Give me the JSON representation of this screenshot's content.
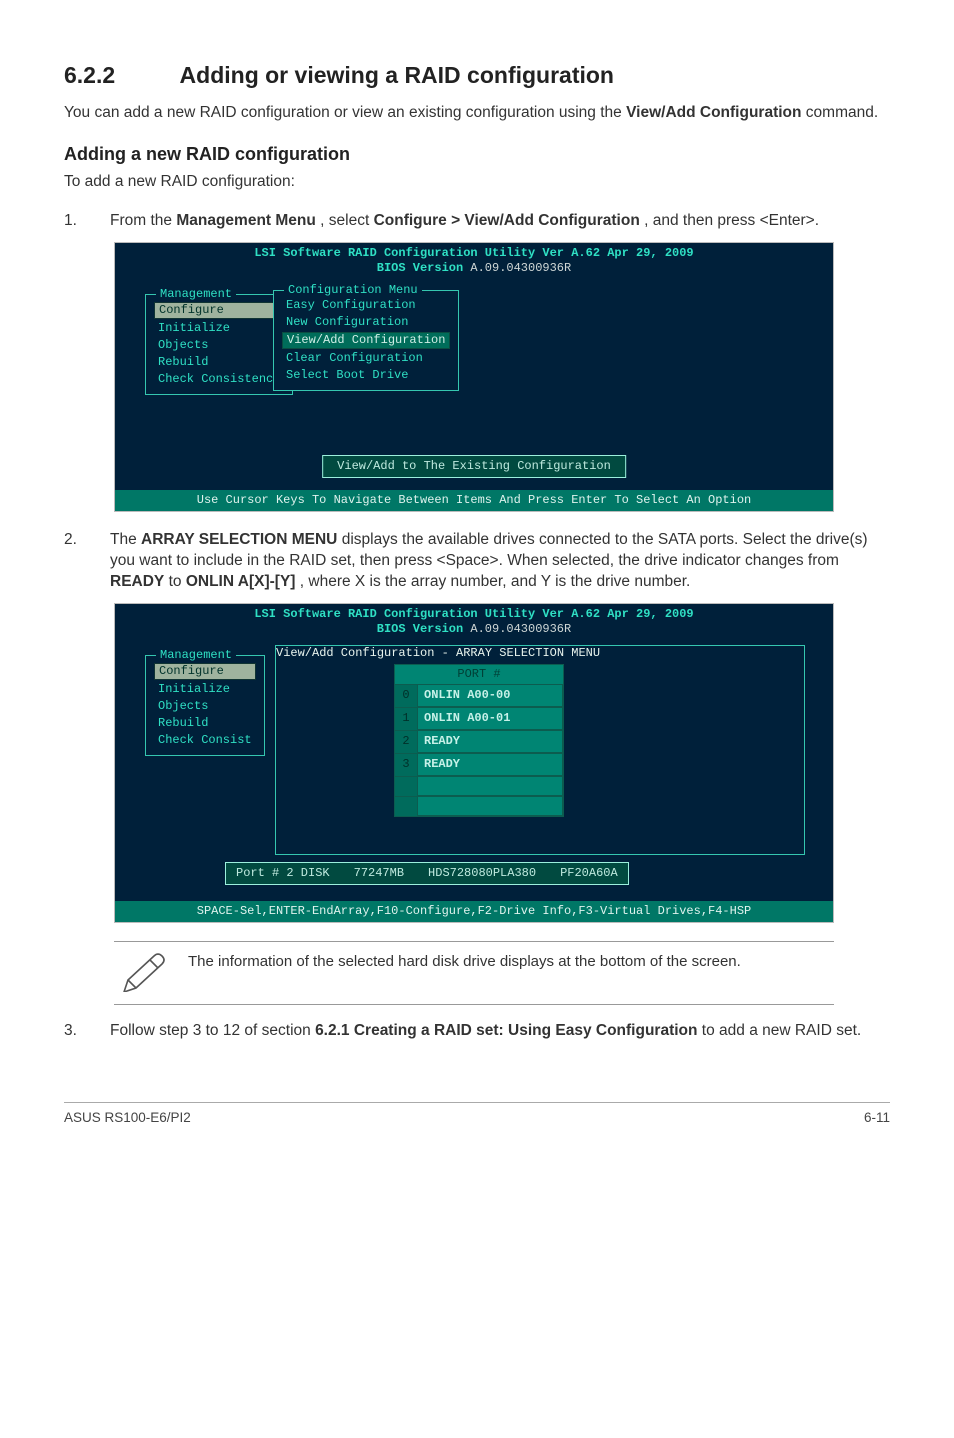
{
  "section": {
    "number": "6.2.2",
    "title": "Adding or viewing a RAID configuration"
  },
  "intro": {
    "p1a": "You can add a new RAID configuration or view an existing configuration using the ",
    "p1b": "View/Add Configuration",
    "p1c": " command."
  },
  "sub": {
    "title": "Adding a new RAID configuration",
    "lead": "To add a new RAID configuration:"
  },
  "steps": {
    "s1": {
      "num": "1.",
      "a": "From the ",
      "b": "Management Menu",
      "c": ", select ",
      "d": "Configure > View/Add Configuration",
      "e": ", and then press <Enter>."
    },
    "s2": {
      "num": "2.",
      "a": "The ",
      "b": "ARRAY SELECTION MENU",
      "c": " displays the available drives connected to the SATA ports. Select the drive(s) you want to include in the RAID set, then press <Space>. When selected, the drive indicator changes from ",
      "d": "READY",
      "e": " to ",
      "f": "ONLIN A[X]-[Y]",
      "g": ", where X is the array number, and Y is the drive number."
    },
    "s3": {
      "num": "3.",
      "a": "Follow step 3 to 12 of section ",
      "b": "6.2.1 Creating a RAID set: Using Easy Configuration",
      "c": " to add a new RAID set."
    }
  },
  "bios1": {
    "hdr1": "LSI Software RAID Configuration Utility Ver A.62 Apr 29, 2009",
    "hdr2a": "BIOS Version ",
    "hdr2b": "A.09.04300936R",
    "mgmt_legend": "Management",
    "mgmt_items": [
      "Configure",
      "Initialize",
      "Objects",
      "Rebuild",
      "Check Consistency"
    ],
    "cfg_legend": "Configuration Menu",
    "cfg_items": [
      "Easy Configuration",
      "New Configuration",
      "View/Add Configuration",
      "Clear Configuration",
      "Select Boot Drive"
    ],
    "help": "View/Add to The Existing Configuration",
    "footer": "Use Cursor Keys To Navigate Between Items And Press Enter To Select An Option"
  },
  "bios2": {
    "hdr1": "LSI Software RAID Configuration Utility Ver A.62 Apr 29, 2009",
    "hdr2a": "BIOS Version ",
    "hdr2b": "A.09.04300936R",
    "mgmt_legend": "Management",
    "mgmt_items": [
      "Configure",
      "Initialize",
      "Objects",
      "Rebuild",
      "Check Consist"
    ],
    "va_legend": "View/Add Configuration - ARRAY SELECTION MENU",
    "port_hdr": "PORT #",
    "port_rows": [
      {
        "idx": "0",
        "val": "ONLIN A00-00"
      },
      {
        "idx": "1",
        "val": "ONLIN A00-01"
      },
      {
        "idx": "2",
        "val": "READY"
      },
      {
        "idx": "3",
        "val": "READY"
      }
    ],
    "info": {
      "a": "Port # 2 DISK",
      "b": "77247MB",
      "c": "HDS728080PLA380",
      "d": "PF20A60A"
    },
    "footer": "SPACE-Sel,ENTER-EndArray,F10-Configure,F2-Drive Info,F3-Virtual Drives,F4-HSP"
  },
  "note": "The information of the selected hard disk drive displays at the bottom of the screen.",
  "footer": {
    "left": "ASUS RS100-E6/PI2",
    "right": "6-11"
  }
}
